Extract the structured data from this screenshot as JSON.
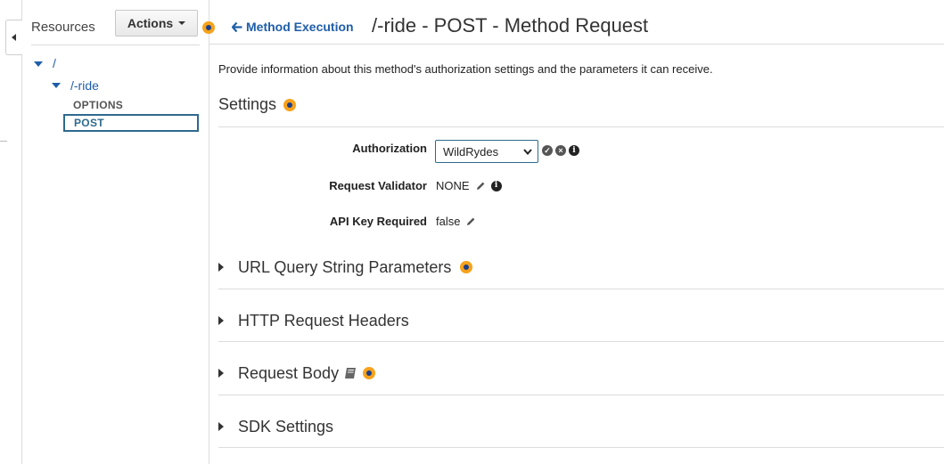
{
  "sidebar": {
    "title": "Resources",
    "actions_label": "Actions",
    "tree": {
      "root": "/",
      "child": "/-ride",
      "methods": [
        "OPTIONS",
        "POST"
      ]
    }
  },
  "header": {
    "back_label": "Method Execution",
    "title": "/-ride - POST - Method Request"
  },
  "main": {
    "description": "Provide information about this method's authorization settings and the parameters it can receive.",
    "settings": {
      "title": "Settings",
      "authorization": {
        "label": "Authorization",
        "value": "WildRydes"
      },
      "request_validator": {
        "label": "Request Validator",
        "value": "NONE"
      },
      "api_key_required": {
        "label": "API Key Required",
        "value": "false"
      }
    },
    "sections": [
      {
        "label": "URL Query String Parameters"
      },
      {
        "label": "HTTP Request Headers"
      },
      {
        "label": "Request Body"
      },
      {
        "label": "SDK Settings"
      }
    ]
  },
  "colors": {
    "link": "#1f5ea8",
    "accent_dot": "#f7a21b",
    "selected_border": "#2e6a8e"
  }
}
